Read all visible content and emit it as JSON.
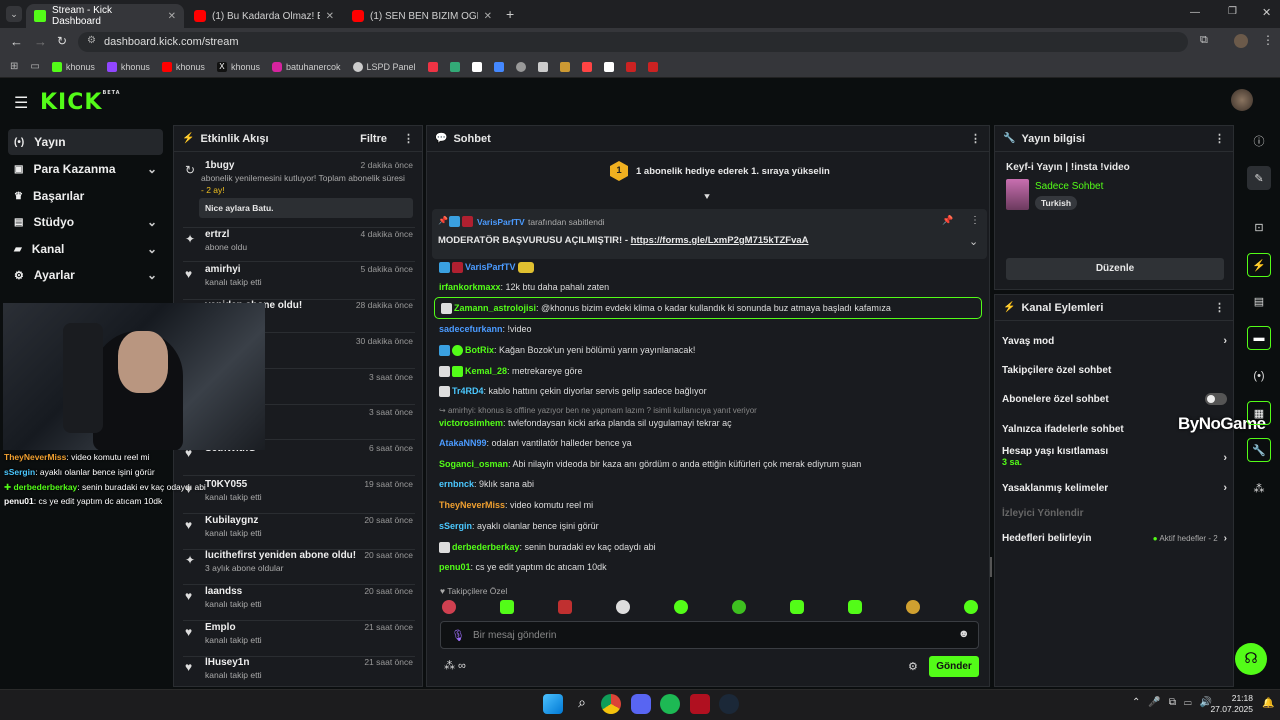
{
  "browser": {
    "tabs": [
      {
        "title": "Stream - Kick Dashboard",
        "color": "#53fc18"
      },
      {
        "title": "(1) Bu Kadarda Olmaz! Esnafın",
        "color": "#ff0000"
      },
      {
        "title": "(1) SEN BEN BİZİM OĞLAN | 55",
        "color": "#ff0000"
      }
    ],
    "url": "dashboard.kick.com/stream",
    "bookmarks": [
      "khonus",
      "khonus",
      "khonus",
      "khonus",
      "batuhanercok",
      "LSPD Panel"
    ]
  },
  "brand": {
    "logo": "KICK",
    "beta": "BETA",
    "accent": "#53fc18"
  },
  "sidebar": {
    "items": [
      {
        "label": "Yayın",
        "icon": "broadcast-icon",
        "active": true
      },
      {
        "label": "Para Kazanma",
        "icon": "wallet-icon",
        "chevron": true
      },
      {
        "label": "Başarılar",
        "icon": "trophy-icon"
      },
      {
        "label": "Stüdyo",
        "icon": "studio-icon",
        "chevron": true
      },
      {
        "label": "Kanal",
        "icon": "channel-icon",
        "chevron": true
      },
      {
        "label": "Ayarlar",
        "icon": "gear-icon",
        "chevron": true
      }
    ]
  },
  "webcam_chat": [
    {
      "user": "TheyNeverMiss",
      "text": ": video komutu reel mi",
      "color": "#f0a030"
    },
    {
      "user": "sSergin",
      "text": ": ayaklı olanlar bence işini görür",
      "color": "#4bc8ff"
    },
    {
      "user": "derbederberkay",
      "text": ": senin buradaki ev kaç odaydı abi",
      "color": "#53fc18"
    },
    {
      "user": "penu01",
      "text": ": cs ye edit yaptım dc atıcam 10dk",
      "color": "#ffffff"
    }
  ],
  "activity": {
    "title": "Etkinlik Akışı",
    "filter": "Filtre",
    "items": [
      {
        "name": "1bugy",
        "time": "2 dakika önce",
        "sub": "abonelik yenilemesini kutluyor! Toplam abonelik süresi",
        "sub2": "- 2 ay!",
        "msg": "Nice aylara Batu."
      },
      {
        "name": "ertrzl",
        "time": "4 dakika önce",
        "sub": "abone oldu"
      },
      {
        "name": "amirhyi",
        "time": "5 dakika önce",
        "sub": "kanalı takip etti"
      },
      {
        "name": "yeniden abone oldu!",
        "time": "28 dakika önce",
        "sub": "oldular"
      },
      {
        "name": "",
        "time": "30 dakika önce",
        "sub": ""
      },
      {
        "name": "",
        "time": "3 saat önce",
        "sub": ""
      },
      {
        "name": "",
        "time": "3 saat önce",
        "sub": ""
      },
      {
        "name": "SethWithG",
        "time": "6 saat önce",
        "sub": ""
      },
      {
        "name": "T0KY055",
        "time": "19 saat önce",
        "sub": "kanalı takip etti"
      },
      {
        "name": "Kubilaygnz",
        "time": "20 saat önce",
        "sub": "kanalı takip etti"
      },
      {
        "name": "lucithefirst yeniden abone oldu!",
        "time": "20 saat önce",
        "sub": "3 aylık abone oldular"
      },
      {
        "name": "laandss",
        "time": "20 saat önce",
        "sub": "kanalı takip etti"
      },
      {
        "name": "Emplo",
        "time": "21 saat önce",
        "sub": "kanalı takip etti"
      },
      {
        "name": "lHusey1n",
        "time": "21 saat önce",
        "sub": "kanalı takip etti"
      }
    ]
  },
  "chat": {
    "title": "Sohbet",
    "gift_banner": "1 abonelik hediye ederek 1. sıraya yükselin",
    "gift_rank": "1",
    "pinned_by": "VarisParfTV",
    "pinned_by_suffix": "tarafından sabitlendi",
    "pinned_text": "MODERATÖR BAŞVURUSU AÇILMIŞTIR! - ",
    "pinned_link": "https://forms.gle/LxmP2gM715kTZFvaA",
    "messages": [
      {
        "user": "VarisParfTV",
        "text": "",
        "color": "#4b9bff"
      },
      {
        "user": "irfankorkmaxx",
        "text": ": 12k btu daha pahalı zaten",
        "color": "#53fc18"
      },
      {
        "user": "Zamann_astrolojisi",
        "text": ": @khonus bizim evdeki klima o kadar kullandık ki sonunda buz atmaya başladı kafamıza",
        "color": "#53fc18"
      },
      {
        "user": "sadecefurkann",
        "text": ": !video",
        "color": "#4b9bff"
      },
      {
        "user": "BotRix",
        "text": ": Kağan Bozok'un yeni bölümü yarın yayınlanacak!",
        "color": "#53fc18"
      },
      {
        "user": "Kemal_28",
        "text": ": metrekareye göre",
        "color": "#53fc18"
      },
      {
        "user": "Tr4RD4",
        "text": ": kablo hattını çekin diyorlar servis gelip sadece bağlıyor",
        "color": "#4bc8ff"
      },
      {
        "user": "victorosimhem",
        "text": ": twlefondaysan kicki arka planda sil uygulamayi tekrar aç",
        "color": "#53fc18",
        "reply": "amirhyi: khonus is offline yazıyor ben ne yapmam lazım ? isimli kullanıcıya yanıt veriyor"
      },
      {
        "user": "AtakaNN99",
        "text": ": odaları vantilatör halleder bence ya",
        "color": "#4b9bff"
      },
      {
        "user": "Soganci_osman",
        "text": ": Abi nilayin videoda bir kaza anı gördüm o anda ettiğin küfürleri çok merak ediyrum şuan",
        "color": "#53fc18"
      },
      {
        "user": "ernbnck",
        "text": ": 9klık sana abi",
        "color": "#4bc8ff"
      },
      {
        "user": "TheyNeverMiss",
        "text": ": video komutu reel mi",
        "color": "#f0a030"
      },
      {
        "user": "sSergin",
        "text": ": ayaklı olanlar bence işini görür",
        "color": "#4bc8ff"
      },
      {
        "user": "derbederberkay",
        "text": ": senin buradaki ev kaç odaydı abi",
        "color": "#53fc18"
      },
      {
        "user": "penu01",
        "text": ": cs ye edit yaptım dc atıcam 10dk",
        "color": "#53fc18"
      }
    ],
    "emote_label": "Takipçilere Özel",
    "input_placeholder": "Bir mesaj gönderin",
    "send_label": "Gönder"
  },
  "stream_info": {
    "title": "Yayın bilgisi",
    "stream_title": "Keyf-i Yayın | !insta !video",
    "category": "Sadece Sohbet",
    "tag": "Turkish",
    "edit_label": "Düzenle"
  },
  "channel_actions": {
    "title": "Kanal Eylemleri",
    "items": [
      {
        "label": "Yavaş mod",
        "type": "chevron"
      },
      {
        "label": "Takipçilere özel sohbet",
        "type": "toggle"
      },
      {
        "label": "Abonelere özel sohbet",
        "type": "toggle"
      },
      {
        "label": "Yalnızca ifadelerle sohbet",
        "type": "toggle"
      },
      {
        "label": "Hesap yaşı kısıtlaması",
        "sub": "3 sa.",
        "type": "chevron"
      },
      {
        "label": "Yasaklanmış kelimeler",
        "type": "chevron"
      },
      {
        "label": "İzleyici Yönlendir",
        "type": "disabled"
      },
      {
        "label": "Hedefleri belirleyin",
        "status": "Aktif hedefler - 2",
        "type": "chevron"
      }
    ]
  },
  "watermark": "ByNoGame",
  "taskbar": {
    "time": "21:18",
    "date": "27.07.2025"
  }
}
